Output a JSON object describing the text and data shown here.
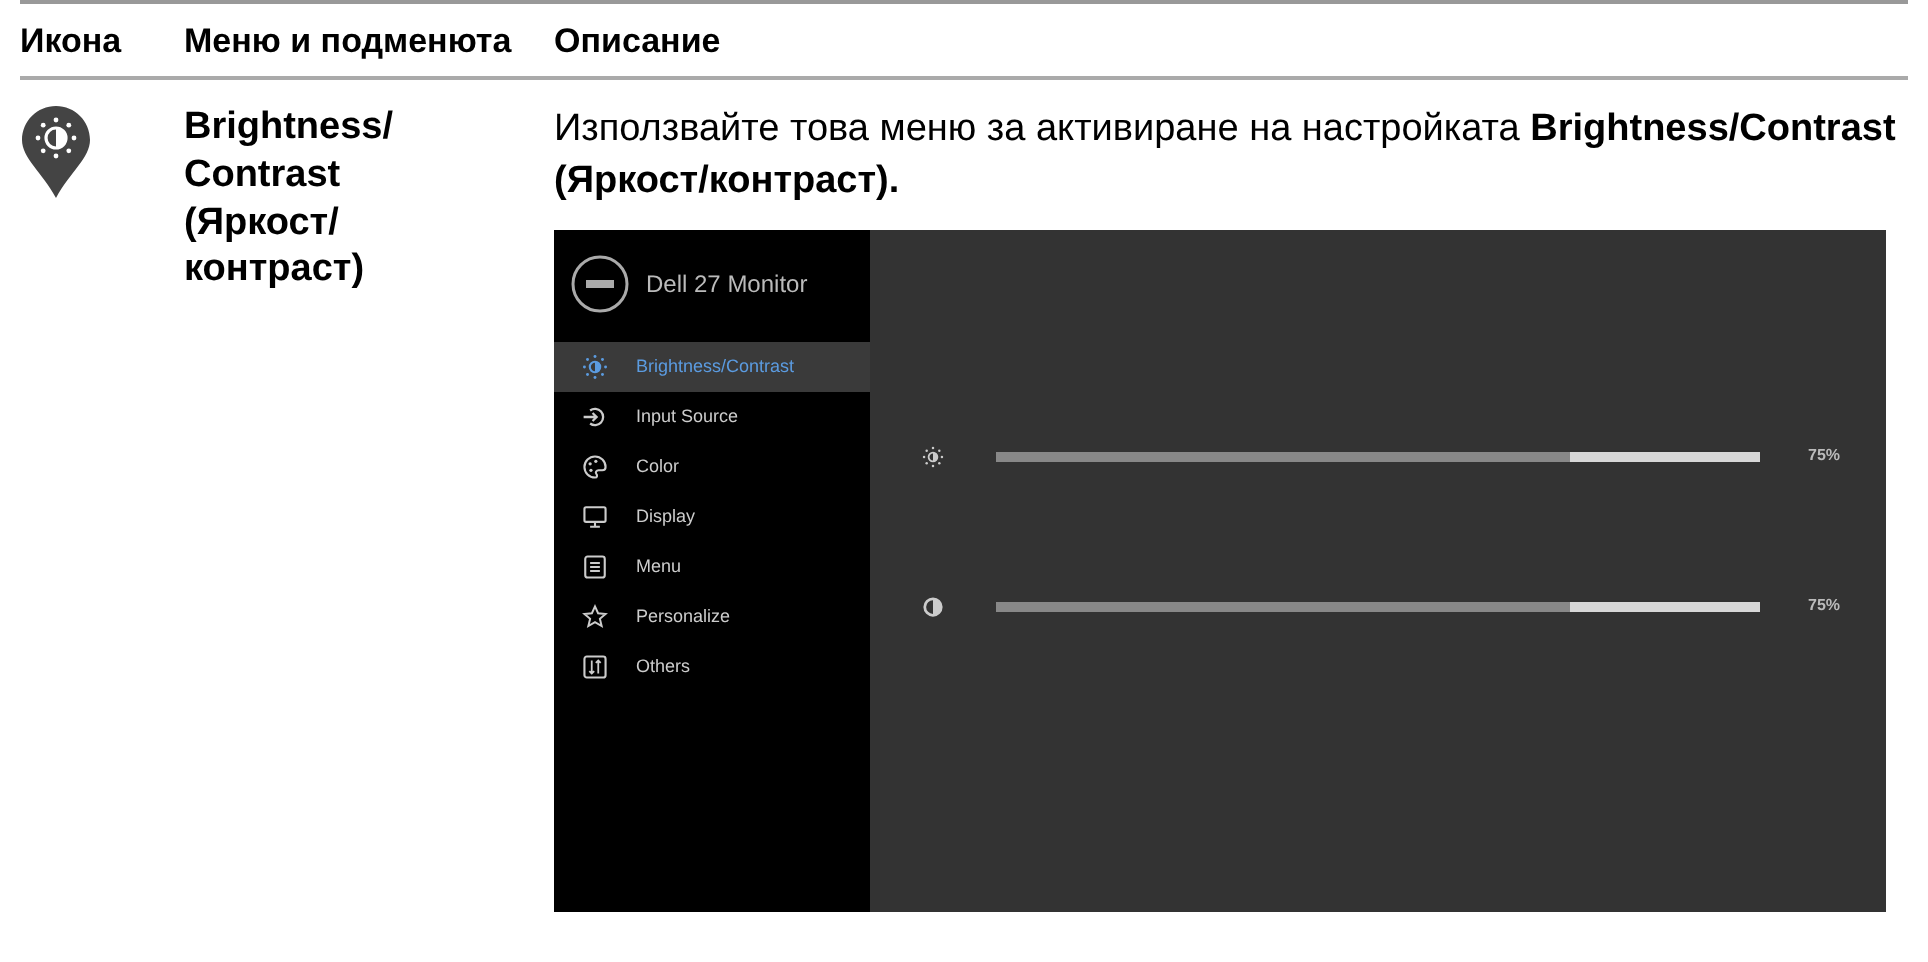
{
  "table": {
    "columns": [
      "Икона",
      "Меню и подменюта",
      "Описание"
    ],
    "rows": [
      {
        "menu_name": "Brightness/ Contrast (Яркост/ контраст)",
        "description": "Използвайте това меню за активиране на настройката **Brightness/Contrast (Яркост/контраст).**",
        "osd": {
          "title": "Dell 27 Monitor",
          "menu_items": [
            {
              "label": "Brightness/Contrast",
              "kind": "brightness",
              "selected": true
            },
            {
              "label": "Input Source",
              "kind": "input",
              "selected": false
            },
            {
              "label": "Color",
              "kind": "color",
              "selected": false
            },
            {
              "label": "Display",
              "kind": "display",
              "selected": false
            },
            {
              "label": "Menu",
              "kind": "menu",
              "selected": false
            },
            {
              "label": "Personalize",
              "kind": "star",
              "selected": false
            },
            {
              "label": "Others",
              "kind": "others",
              "selected": false
            }
          ],
          "sliders": [
            {
              "kind": "brightness",
              "level": 0.75,
              "reading": "75%"
            },
            {
              "kind": "contrast",
              "level": 0.75,
              "reading": "75%"
            }
          ]
        }
      }
    ]
  }
}
